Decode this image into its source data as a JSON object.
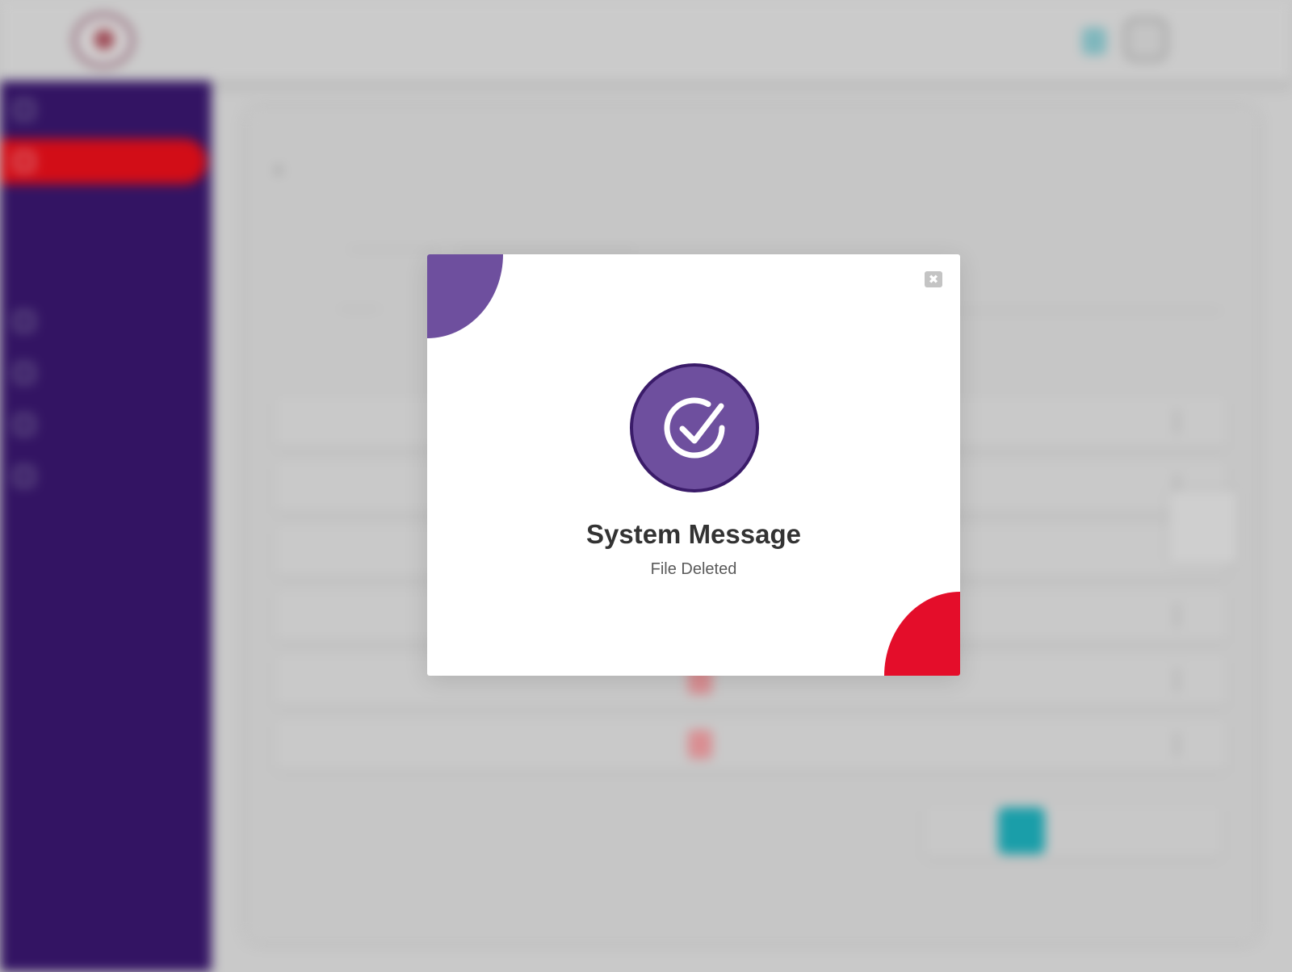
{
  "colors": {
    "sidebar_bg": "#331463",
    "active_nav_bg": "#d20d17",
    "modal_accent_purple": "#6e4f9e",
    "modal_icon_ring": "#3a1b69",
    "modal_accent_red": "#e40d2a",
    "overlay_bg": "#c9c9c9",
    "link_teal": "#3bb3bf"
  },
  "icons": {
    "close": "close-icon",
    "success": "check-circle-icon"
  },
  "modal": {
    "title": "System Message",
    "message": "File Deleted",
    "close_glyph": "✖"
  }
}
